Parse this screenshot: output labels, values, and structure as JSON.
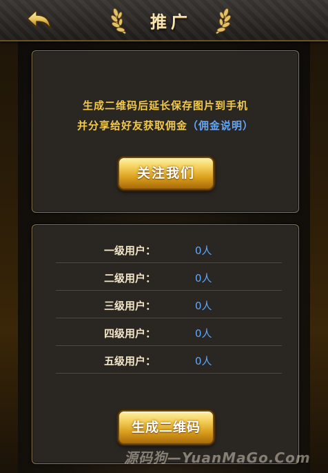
{
  "header": {
    "title": "推广",
    "back_icon": "back-arrow-icon",
    "laurel_icon": "laurel-icon"
  },
  "top_panel": {
    "line1": "生成二维码后延长保存图片到手机",
    "line2_prefix": "并分享给好友获取佣金",
    "line2_link": "（佣金说明）",
    "follow_button": "关注我们"
  },
  "user_levels": [
    {
      "label": "一级用户：",
      "value": "0人"
    },
    {
      "label": "二级用户：",
      "value": "0人"
    },
    {
      "label": "三级用户：",
      "value": "0人"
    },
    {
      "label": "四级用户：",
      "value": "0人"
    },
    {
      "label": "五级用户：",
      "value": "0人"
    }
  ],
  "generate_qr_button": "生成二维码",
  "watermark": "源码狗—YuanMaGo.Com",
  "colors": {
    "accent_gold": "#f2c94a",
    "link_blue": "#5ea8ff",
    "panel_border": "#8b7a55"
  }
}
